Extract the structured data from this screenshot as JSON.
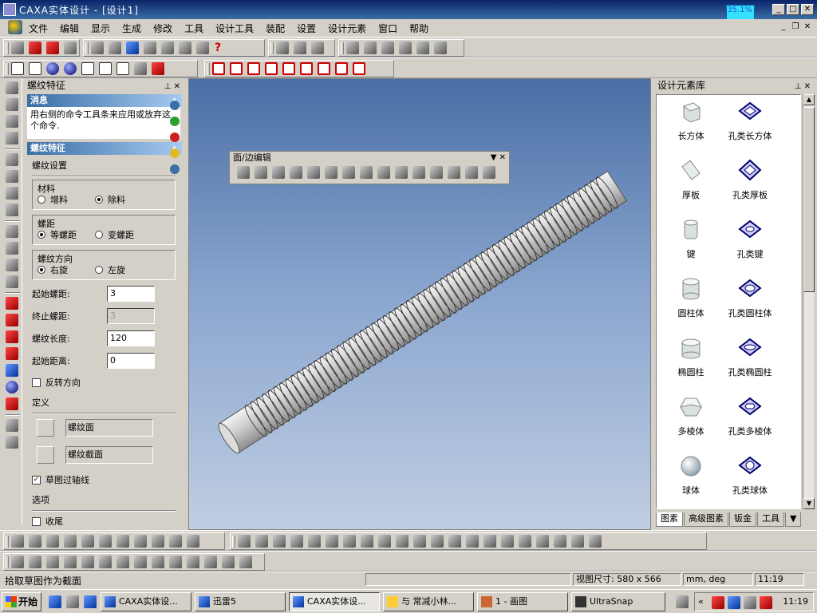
{
  "window": {
    "title": "CAXA实体设计 - [设计1]",
    "cpu_readout": "35.1%"
  },
  "menubar": {
    "items": [
      "文件",
      "编辑",
      "显示",
      "生成",
      "修改",
      "工具",
      "设计工具",
      "装配",
      "设置",
      "设计元素",
      "窗口",
      "帮助"
    ]
  },
  "thread_panel": {
    "title": "螺纹特征",
    "message_header": "消息",
    "message_text": "用右侧的命令工具条来应用或放弃这个命令.",
    "feature_header": "螺纹特征",
    "settings_label": "螺纹设置",
    "material": {
      "label": "材料",
      "options": [
        "增料",
        "除料"
      ],
      "selected": "除料"
    },
    "pitch": {
      "label": "螺距",
      "options": [
        "等螺距",
        "变螺距"
      ],
      "selected": "等螺距"
    },
    "direction": {
      "label": "螺纹方向",
      "options": [
        "右旋",
        "左旋"
      ],
      "selected": "右旋"
    },
    "fields": {
      "start_pitch": {
        "label": "起始螺距:",
        "value": "3"
      },
      "end_pitch": {
        "label": "终止螺距:",
        "value": "3"
      },
      "thread_length": {
        "label": "螺纹长度:",
        "value": "120"
      },
      "start_distance": {
        "label": "起始距离:",
        "value": "0"
      }
    },
    "reverse_label": "反转方向",
    "define_label": "定义",
    "thread_face": "螺纹面",
    "thread_section": "螺纹截面",
    "sketch_axis_label": "草图过轴线",
    "options_label": "选项",
    "tail_label": "收尾"
  },
  "viewport": {
    "floating_toolbar_title": "面/边编辑"
  },
  "library": {
    "title": "设计元素库",
    "items": [
      {
        "name": "长方体",
        "icon": "cuboid-icon"
      },
      {
        "name": "孔类长方体",
        "icon": "cuboid-hole-icon"
      },
      {
        "name": "厚板",
        "icon": "plate-icon"
      },
      {
        "name": "孔类厚板",
        "icon": "plate-hole-icon"
      },
      {
        "name": "键",
        "icon": "key-icon"
      },
      {
        "name": "孔类键",
        "icon": "key-hole-icon"
      },
      {
        "name": "圆柱体",
        "icon": "cylinder-icon"
      },
      {
        "name": "孔类圆柱体",
        "icon": "cylinder-hole-icon"
      },
      {
        "name": "椭圆柱",
        "icon": "elliptic-cylinder-icon"
      },
      {
        "name": "孔类椭圆柱",
        "icon": "elliptic-cylinder-hole-icon"
      },
      {
        "name": "多棱体",
        "icon": "prism-icon"
      },
      {
        "name": "孔类多棱体",
        "icon": "prism-hole-icon"
      },
      {
        "name": "球体",
        "icon": "sphere-icon"
      },
      {
        "name": "孔类球体",
        "icon": "sphere-hole-icon"
      }
    ],
    "tabs": [
      "图素",
      "高级图素",
      "钣金",
      "工具"
    ]
  },
  "statusbar": {
    "prompt": "拾取草图作为截面",
    "view_size": "视图尺寸: 580 x 566",
    "units": "mm, deg",
    "time": "11:19"
  },
  "taskbar": {
    "start": "开始",
    "tasks": [
      "CAXA实体设...",
      "迅雷5",
      "CAXA实体设...",
      "与 常减小林...",
      "1 - 画图",
      "UltraSnap"
    ],
    "clock": "11:19"
  },
  "colors": {
    "title_gradient_start": "#0a246a",
    "viewport_top": "#4a6fa5",
    "viewport_bottom": "#c0cee2",
    "face_3d": "#d4d0c8"
  }
}
